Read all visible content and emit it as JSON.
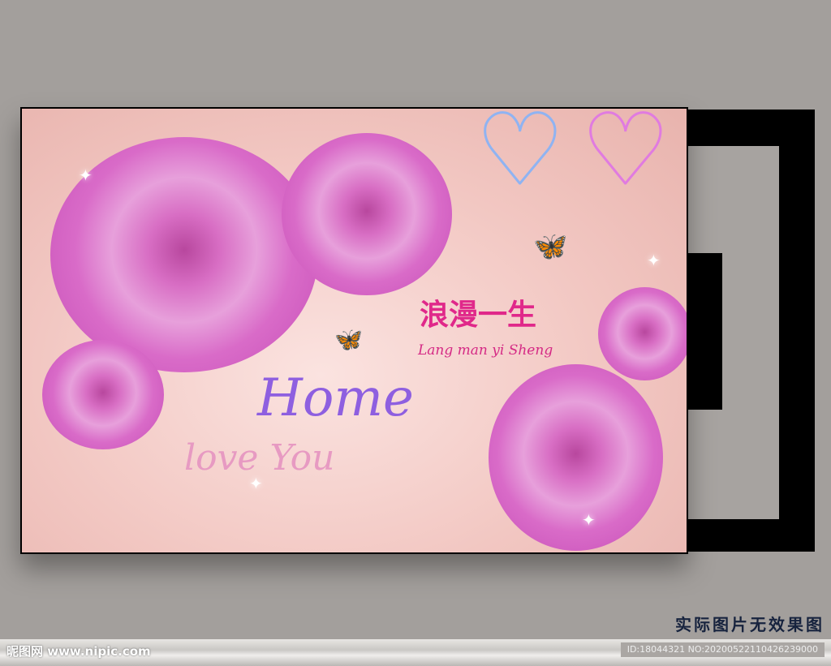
{
  "artwork": {
    "title_cn": "浪漫一生",
    "pinyin": "Lang man yi Sheng",
    "headline": "Home",
    "subline": "love You"
  },
  "caption": "实际图片无效果图",
  "watermark": {
    "logo": "昵图网 www.nipic.com",
    "id": "ID:18044321 NO:20200522110426239000"
  }
}
